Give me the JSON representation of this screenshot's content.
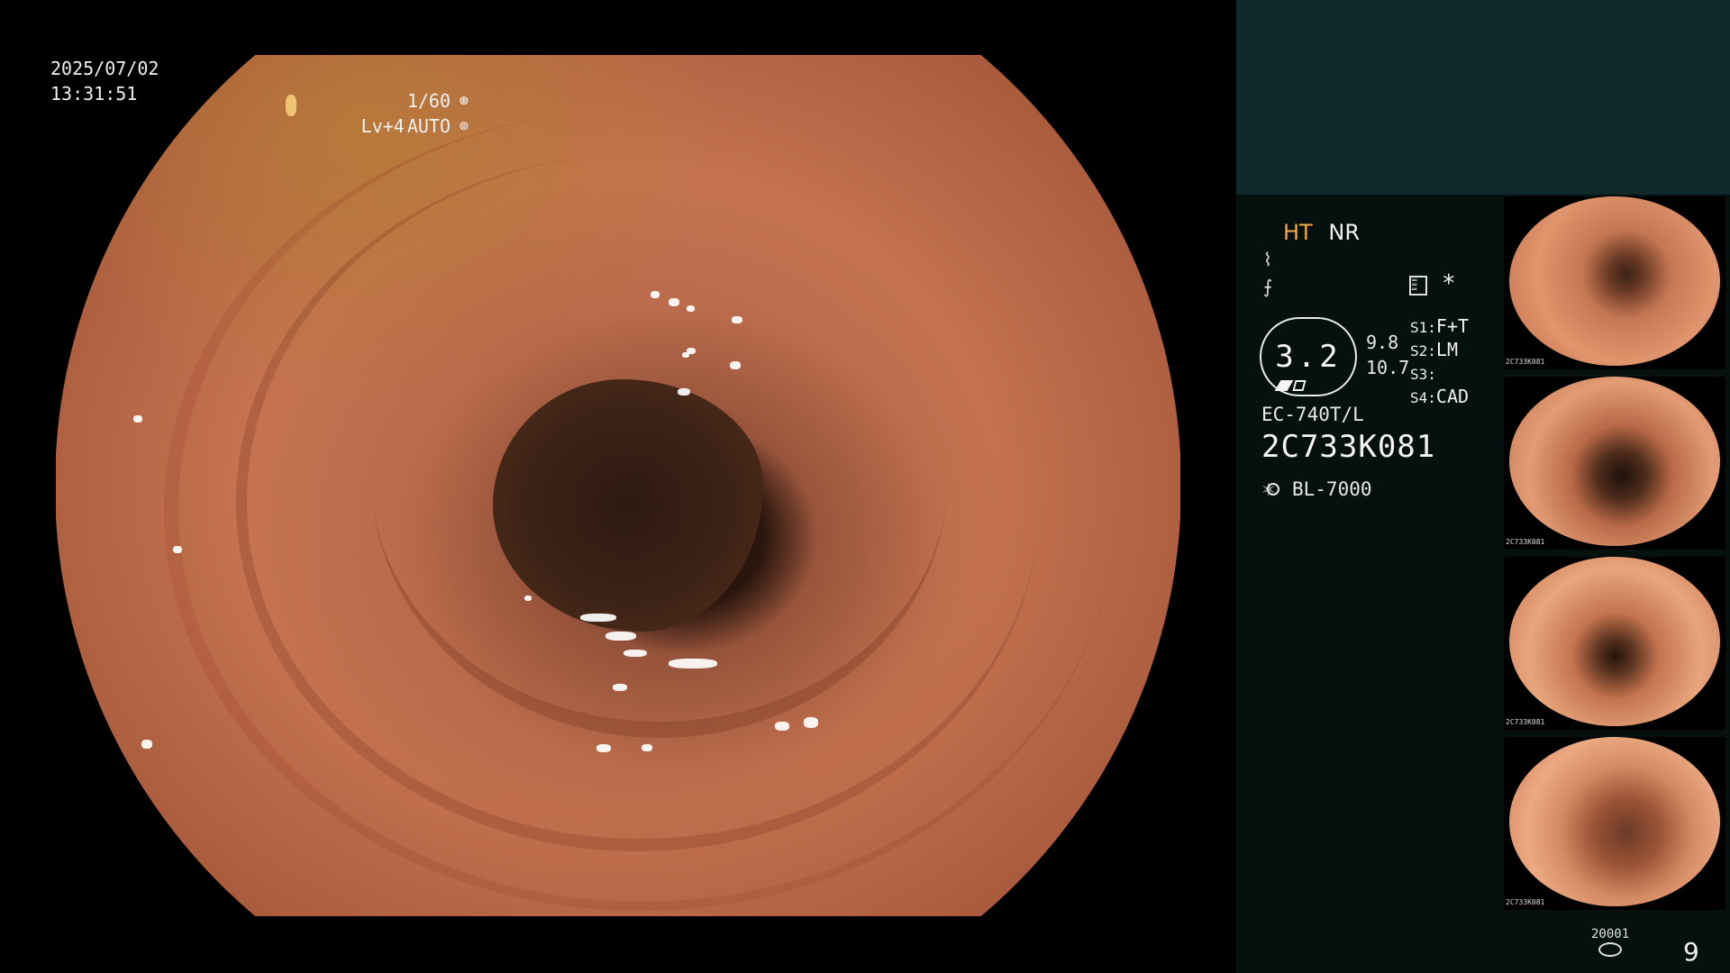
{
  "main_view": {
    "date": "2025/07/02",
    "time": "13:31:51",
    "shutter_speed": "1/60",
    "brightness_level": "Lv+4",
    "exposure_mode": "AUTO",
    "shutter_icon": "shutter-icon",
    "auto_icon": "iris-icon"
  },
  "side_panel": {
    "image_modes": {
      "ht": "HT",
      "nr": "NR"
    },
    "colors": {
      "ht": "#f0a84a",
      "panel_top": "#0e2a2b",
      "panel_bg": "#06100f"
    },
    "symbols": {
      "row1": "⌇",
      "row2": "⨍"
    },
    "zoom": {
      "value": "3.2",
      "side_top": "9.8",
      "side_bottom": "10.7"
    },
    "switches": [
      {
        "key": "S1:",
        "value": "F+T"
      },
      {
        "key": "S2:",
        "value": "LM"
      },
      {
        "key": "S3:",
        "value": ""
      },
      {
        "key": "S4:",
        "value": "CAD"
      }
    ],
    "asterisk": "*",
    "scope_model": "EC-740T/L",
    "scope_serial": "2C733K081",
    "light_source": "BL-7000",
    "thumbnails": [
      {
        "serial": "2C733K081"
      },
      {
        "serial": "2C733K081"
      },
      {
        "serial": "2C733K081"
      },
      {
        "serial": "2C733K081"
      }
    ],
    "storage_label": "20001",
    "image_count": "9"
  }
}
